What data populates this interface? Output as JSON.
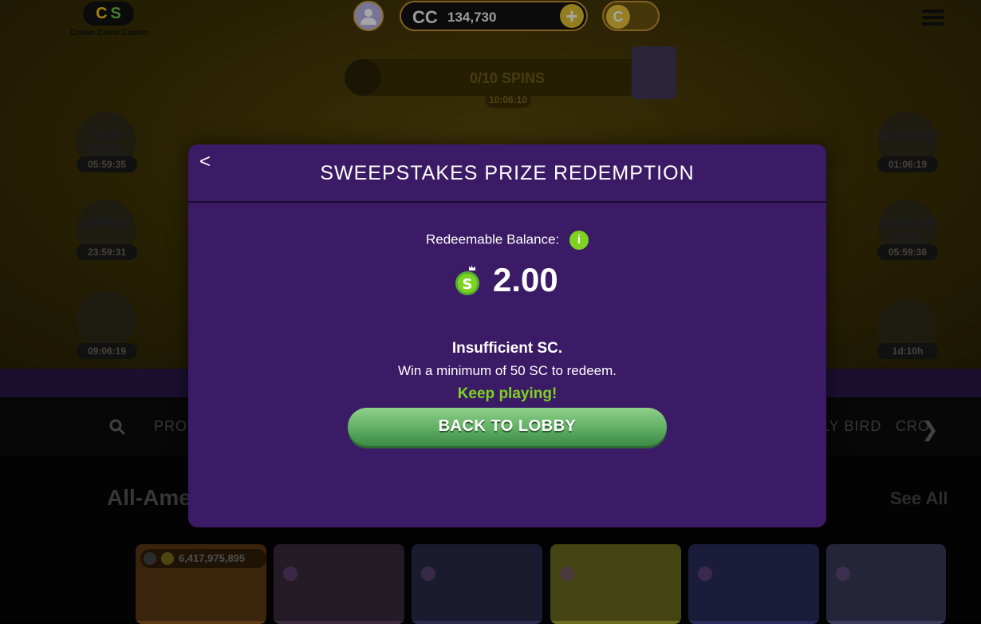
{
  "header": {
    "logo_text": "Crown Coins Casino",
    "logo_letters": [
      "C",
      "S"
    ],
    "currency_label": "CC",
    "balance": "134,730",
    "add_label": "+",
    "toggle_coin_label": "C"
  },
  "spins": {
    "label": "0/10 SPINS",
    "timer": "10:06:10"
  },
  "promos": {
    "left": [
      {
        "label": "DICE DEAL",
        "timer": "05:59:35"
      },
      {
        "label": "OFFER",
        "timer": "23:59:31"
      },
      {
        "label": "",
        "timer": "09:06:19"
      }
    ],
    "right": [
      {
        "label": "MYSTERY",
        "timer": "01:06:19"
      },
      {
        "label": "CHOOSE ONE",
        "timer": "05:59:36"
      },
      {
        "label": "1",
        "timer": "1d:10h"
      }
    ]
  },
  "nav": {
    "items": [
      "PROV",
      "LY BIRD",
      "CRO"
    ]
  },
  "section": {
    "title": "All-Ame",
    "see_all": "See All"
  },
  "games": {
    "jackpot": "6,417,975,895"
  },
  "modal": {
    "back_label": "<",
    "title": "SWEEPSTAKES PRIZE REDEMPTION",
    "balance_label": "Redeemable Balance:",
    "info_label": "i",
    "coin_label": "S",
    "balance_value": "2.00",
    "insufficient": "Insufficient SC.",
    "minimum_message": "Win a minimum of 50 SC to redeem.",
    "keep_playing": "Keep playing!",
    "lobby_button": "BACK TO LOBBY"
  },
  "colors": {
    "modal_bg": "#3b1a66",
    "accent_green": "#7ed321",
    "button_green": "#5fae62",
    "gold": "#c8962e"
  }
}
